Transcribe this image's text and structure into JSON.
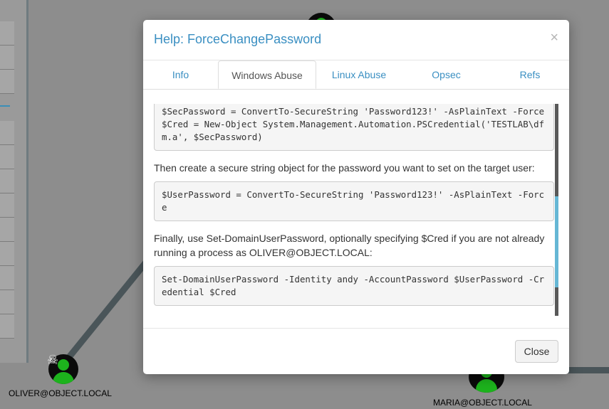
{
  "graph": {
    "nodes": [
      {
        "label": "OLIVER@OBJECT.LOCAL"
      },
      {
        "label": "MARIA@OBJECT.LOCAL"
      }
    ],
    "skull_glyph": "☠"
  },
  "modal": {
    "title": "Help: ForceChangePassword",
    "close_glyph": "×",
    "tabs": [
      "Info",
      "Windows Abuse",
      "Linux Abuse",
      "Opsec",
      "Refs"
    ],
    "active_tab": "Windows Abuse",
    "content": {
      "code1": "$SecPassword = ConvertTo-SecureString 'Password123!' -AsPlainText -Force\n$Cred = New-Object System.Management.Automation.PSCredential('TESTLAB\\dfm.a', $SecPassword)",
      "para1": "Then create a secure string object for the password you want to set on the target user:",
      "code2": "$UserPassword = ConvertTo-SecureString 'Password123!' -AsPlainText -Force",
      "para2": "Finally, use Set-DomainUserPassword, optionally specifying $Cred if you are not already running a process as OLIVER@OBJECT.LOCAL:",
      "code3": "Set-DomainUserPassword -Identity andy -AccountPassword $UserPassword -Credential $Cred"
    },
    "close_button": "Close"
  }
}
